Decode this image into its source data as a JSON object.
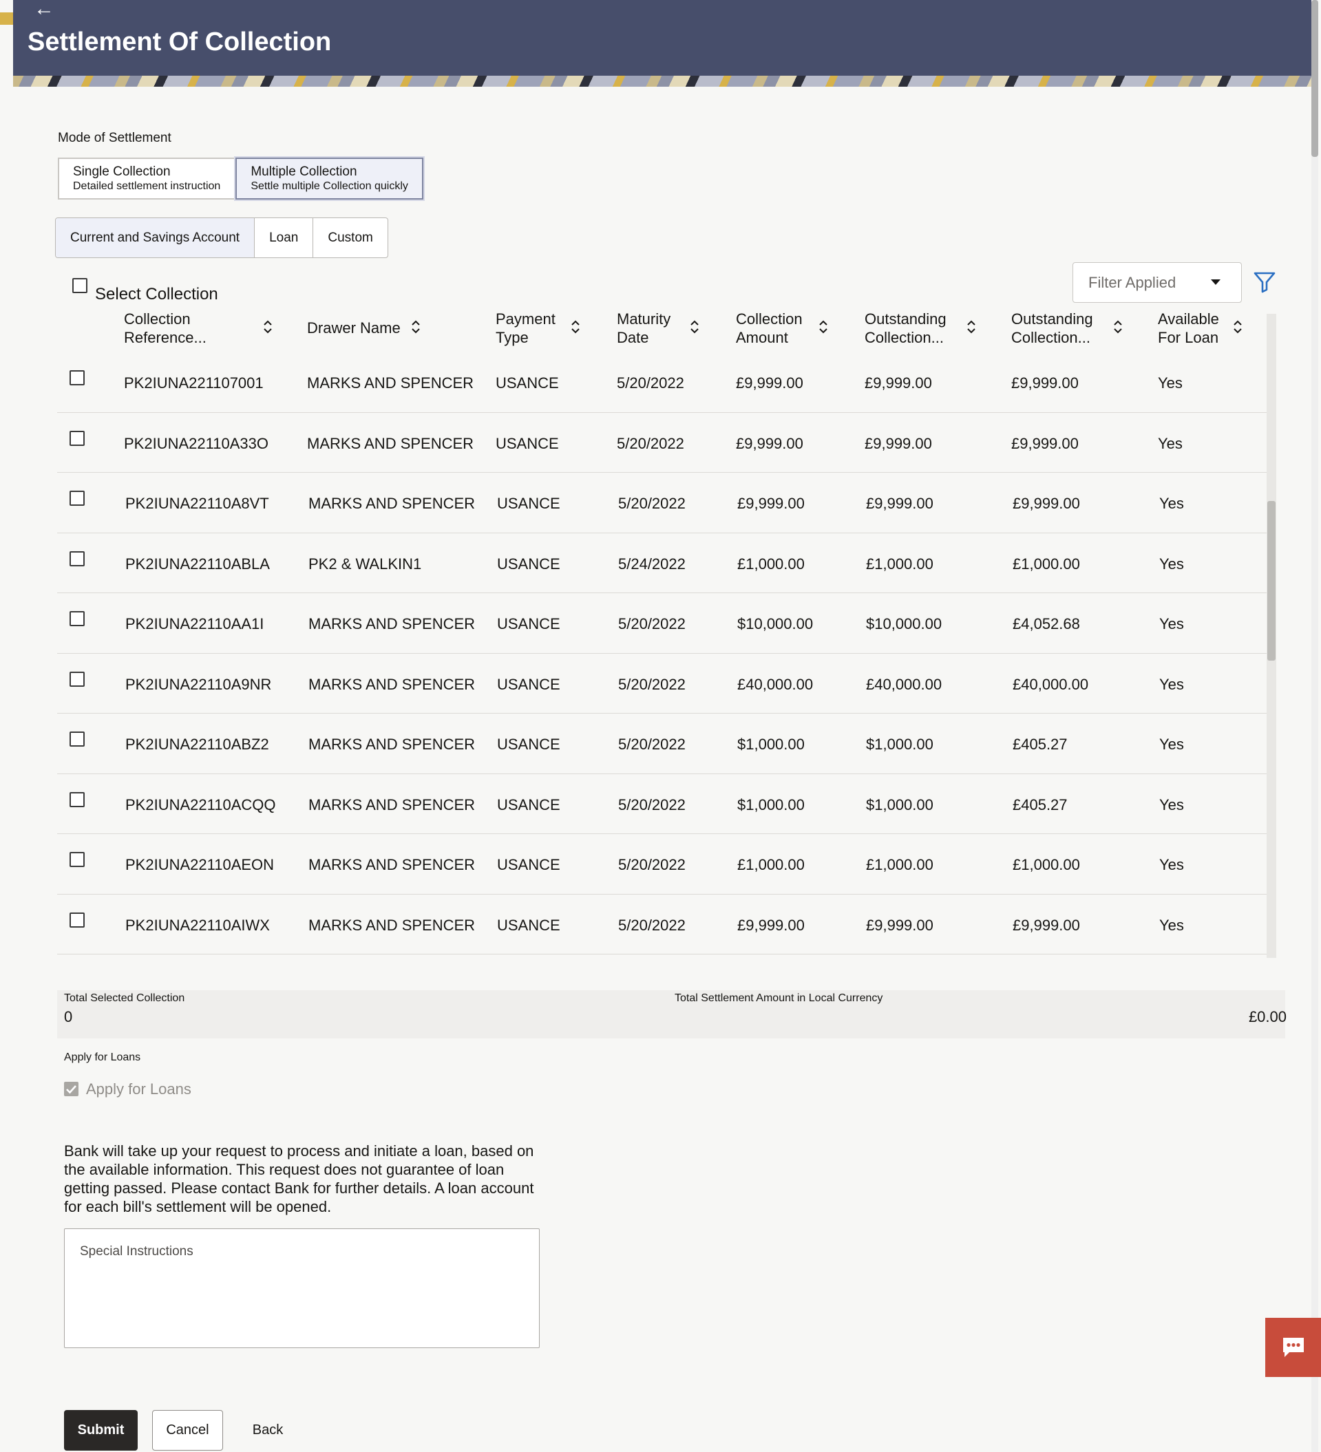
{
  "header": {
    "title": "Settlement Of Collection"
  },
  "mode": {
    "label": "Mode of Settlement",
    "options": [
      {
        "title": "Single Collection",
        "subtitle": "Detailed settlement instruction"
      },
      {
        "title": "Multiple Collection",
        "subtitle": "Settle multiple Collection quickly"
      }
    ],
    "selected": "Multiple Collection"
  },
  "tabs": [
    "Current and Savings Account",
    "Loan",
    "Custom"
  ],
  "filter": {
    "value": "Filter Applied"
  },
  "table": {
    "select_all_label": "Select Collection",
    "columns": [
      {
        "line1": "Collection",
        "line2": "Reference..."
      },
      {
        "line1": "Drawer Name",
        "line2": ""
      },
      {
        "line1": "Payment",
        "line2": "Type"
      },
      {
        "line1": "Maturity",
        "line2": "Date"
      },
      {
        "line1": "Collection",
        "line2": "Amount"
      },
      {
        "line1": "Outstanding",
        "line2": "Collection..."
      },
      {
        "line1": "Outstanding",
        "line2": "Collection..."
      },
      {
        "line1": "Available",
        "line2": "For Loan"
      }
    ],
    "rows": [
      [
        "PK2IUNA221107001",
        "MARKS AND SPENCER",
        "USANCE",
        "5/20/2022",
        "£9,999.00",
        "£9,999.00",
        "£9,999.00",
        "Yes"
      ],
      [
        "PK2IUNA22110A33O",
        "MARKS AND SPENCER",
        "USANCE",
        "5/20/2022",
        "£9,999.00",
        "£9,999.00",
        "£9,999.00",
        "Yes"
      ],
      [
        "PK2IUNA22110A8VT",
        "MARKS AND SPENCER",
        "USANCE",
        "5/20/2022",
        "£9,999.00",
        "£9,999.00",
        "£9,999.00",
        "Yes"
      ],
      [
        "PK2IUNA22110ABLA",
        "PK2 & WALKIN1",
        "USANCE",
        "5/24/2022",
        "£1,000.00",
        "£1,000.00",
        "£1,000.00",
        "Yes"
      ],
      [
        "PK2IUNA22110AA1I",
        "MARKS AND SPENCER",
        "USANCE",
        "5/20/2022",
        "$10,000.00",
        "$10,000.00",
        "£4,052.68",
        "Yes"
      ],
      [
        "PK2IUNA22110A9NR",
        "MARKS AND SPENCER",
        "USANCE",
        "5/20/2022",
        "£40,000.00",
        "£40,000.00",
        "£40,000.00",
        "Yes"
      ],
      [
        "PK2IUNA22110ABZ2",
        "MARKS AND SPENCER",
        "USANCE",
        "5/20/2022",
        "$1,000.00",
        "$1,000.00",
        "£405.27",
        "Yes"
      ],
      [
        "PK2IUNA22110ACQQ",
        "MARKS AND SPENCER",
        "USANCE",
        "5/20/2022",
        "$1,000.00",
        "$1,000.00",
        "£405.27",
        "Yes"
      ],
      [
        "PK2IUNA22110AEON",
        "MARKS AND SPENCER",
        "USANCE",
        "5/20/2022",
        "£1,000.00",
        "£1,000.00",
        "£1,000.00",
        "Yes"
      ],
      [
        "PK2IUNA22110AIWX",
        "MARKS AND SPENCER",
        "USANCE",
        "5/20/2022",
        "£9,999.00",
        "£9,999.00",
        "£9,999.00",
        "Yes"
      ]
    ]
  },
  "totals": {
    "selected_label": "Total Selected Collection",
    "selected_value": "0",
    "settlement_label": "Total Settlement Amount in Local Currency",
    "settlement_value": "£0.00"
  },
  "loans": {
    "section_label": "Apply for Loans",
    "checkbox_label": "Apply for Loans",
    "checked": true,
    "disclaimer": "Bank will take up your request to process and initiate a loan, based on the available information. This request does not guarantee of loan getting passed. Please contact Bank for further details. A loan account for each bill's settlement will be opened."
  },
  "instructions": {
    "placeholder": "Special Instructions"
  },
  "actions": {
    "submit": "Submit",
    "cancel": "Cancel",
    "back": "Back"
  },
  "colors": {
    "header_bg": "#474e6b",
    "chat_button": "#c84c3b",
    "submit_bg": "#2a2826",
    "filter_icon": "#2a6fc2"
  },
  "icons": [
    "back-arrow-icon",
    "sort-icon",
    "filter-icon",
    "chevron-down-icon",
    "checkmark-icon",
    "chat-icon"
  ]
}
